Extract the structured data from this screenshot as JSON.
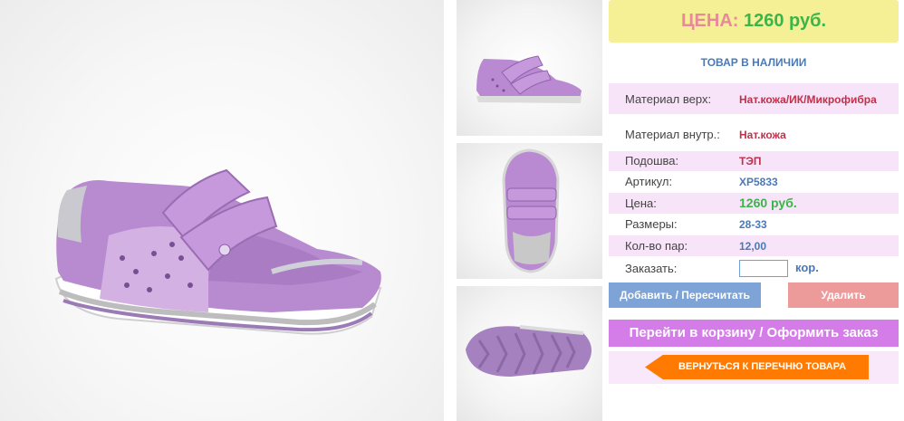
{
  "images": {
    "main": "shoe-side-view",
    "thumbnails": [
      "shoe-side-view",
      "shoe-top-view",
      "shoe-sole-view"
    ]
  },
  "price_header": {
    "label": "ЦЕНА:",
    "value": "1260 руб."
  },
  "stock_status": "ТОВАР В НАЛИЧИИ",
  "specs": [
    {
      "label": "Материал верх:",
      "value": "Нат.кожа/ИК/Микрофибра"
    },
    {
      "label": "Материал внутр.:",
      "value": "Нат.кожа"
    },
    {
      "label": "Подошва:",
      "value": "ТЭП"
    },
    {
      "label": "Артикул:",
      "value": "XP5833"
    },
    {
      "label": "Цена:",
      "value": "1260 руб."
    },
    {
      "label": "Размеры:",
      "value": "28-33"
    },
    {
      "label": "Кол-во пар:",
      "value": "12,00"
    }
  ],
  "order": {
    "label": "Заказать:",
    "value": "",
    "unit": "кор."
  },
  "buttons": {
    "add": "Добавить / Пересчитать",
    "delete": "Удалить",
    "cart": "Перейти в корзину / Оформить заказ",
    "back": "ВЕРНУТЬСЯ К ПЕРЕЧНЮ ТОВАРА"
  },
  "colors": {
    "price_bg": "#f5ef95",
    "price_label": "#e8899a",
    "price_value": "#3ab54a",
    "row_pink": "#f8e4f8",
    "add_button": "#7ea3d6",
    "delete_button": "#ec9a9a",
    "cart_button": "#d47de8",
    "back_button": "#ff7a00"
  }
}
